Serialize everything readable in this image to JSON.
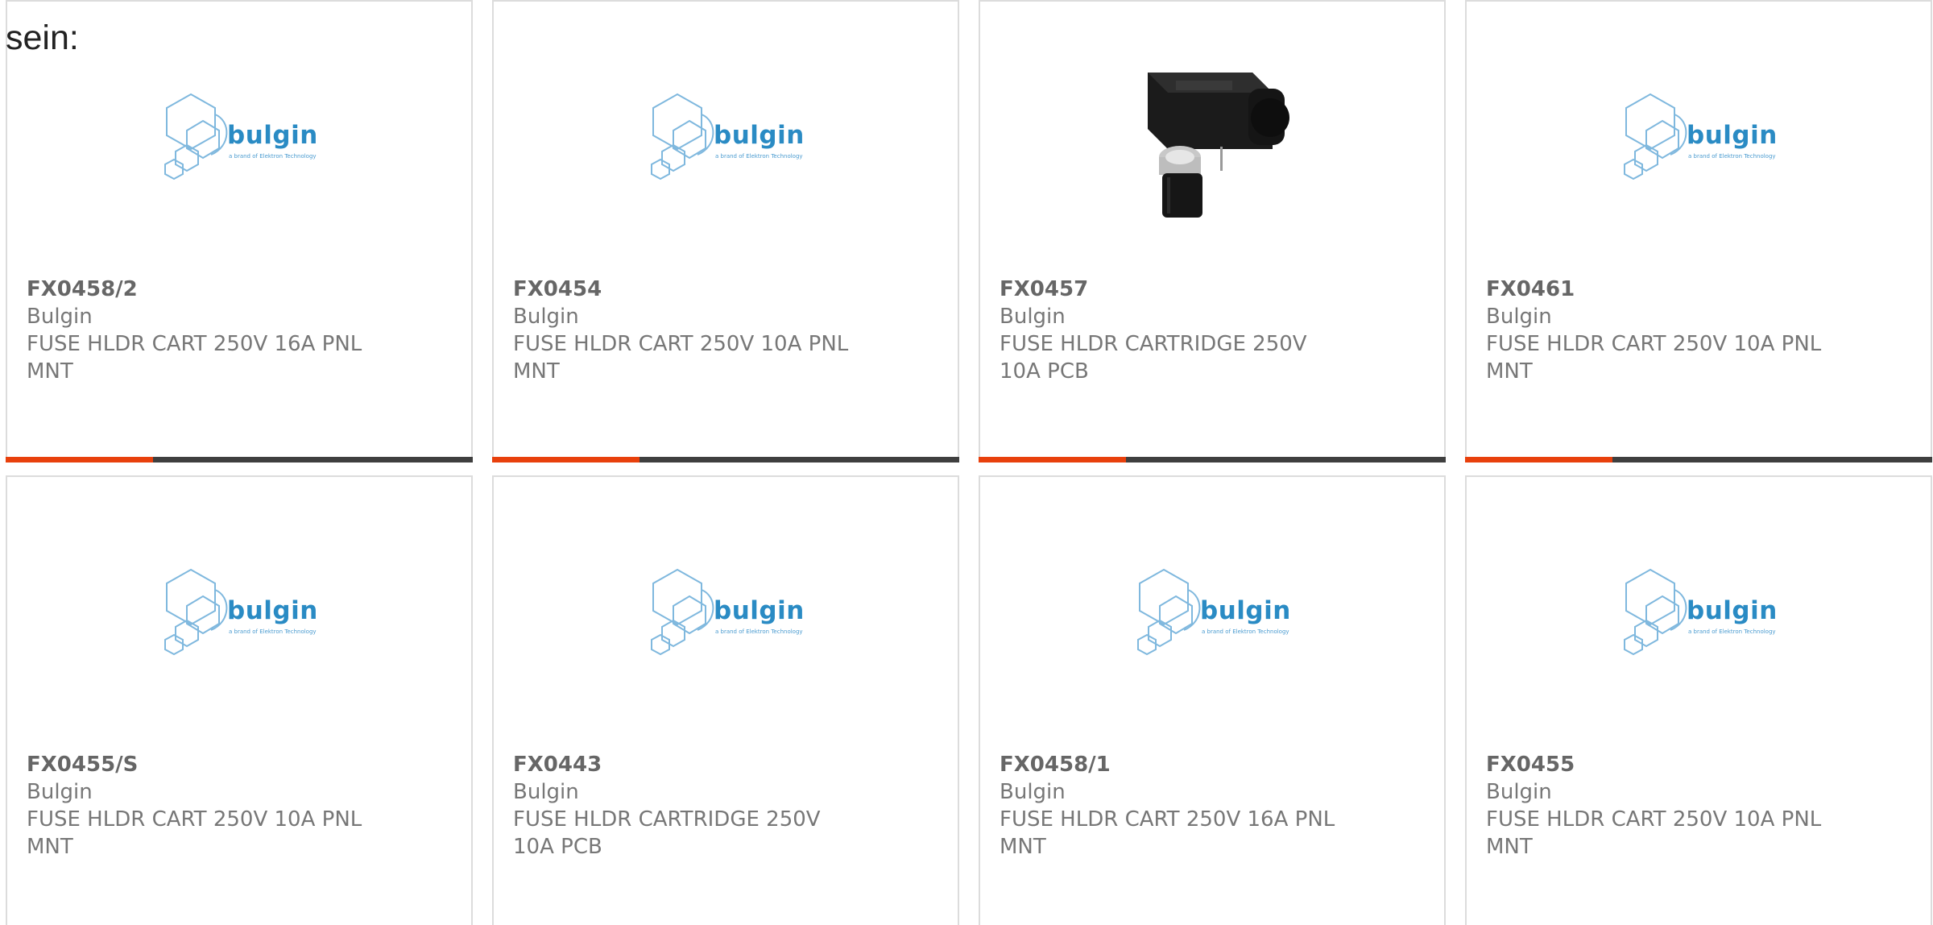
{
  "intro_text": "sein:",
  "colors": {
    "accent": "#e8400c",
    "bar": "#3f3f3f",
    "logo_blue": "#2a8bc4",
    "card_border": "#dcdcdc"
  },
  "logo": {
    "wordmark": "bulgin",
    "tagline": "a brand of Elektron Technology"
  },
  "products": [
    {
      "part": "FX0458/2",
      "manufacturer": "Bulgin",
      "description": "FUSE HLDR CART 250V 16A PNL MNT",
      "image": "bulgin-logo"
    },
    {
      "part": "FX0454",
      "manufacturer": "Bulgin",
      "description": "FUSE HLDR CART 250V 10A PNL MNT",
      "image": "bulgin-logo"
    },
    {
      "part": "FX0457",
      "manufacturer": "Bulgin",
      "description": "FUSE HLDR CARTRIDGE 250V 10A PCB",
      "image": "product-photo"
    },
    {
      "part": "FX0461",
      "manufacturer": "Bulgin",
      "description": "FUSE HLDR CART 250V 10A PNL MNT",
      "image": "bulgin-logo"
    },
    {
      "part": "FX0455/S",
      "manufacturer": "Bulgin",
      "description": "FUSE HLDR CART 250V 10A PNL MNT",
      "image": "bulgin-logo"
    },
    {
      "part": "FX0443",
      "manufacturer": "Bulgin",
      "description": "FUSE HLDR CARTRIDGE 250V 10A PCB",
      "image": "bulgin-logo"
    },
    {
      "part": "FX0458/1",
      "manufacturer": "Bulgin",
      "description": "FUSE HLDR CART 250V 16A PNL MNT",
      "image": "bulgin-logo"
    },
    {
      "part": "FX0455",
      "manufacturer": "Bulgin",
      "description": "FUSE HLDR CART 250V 10A PNL MNT",
      "image": "bulgin-logo"
    }
  ]
}
